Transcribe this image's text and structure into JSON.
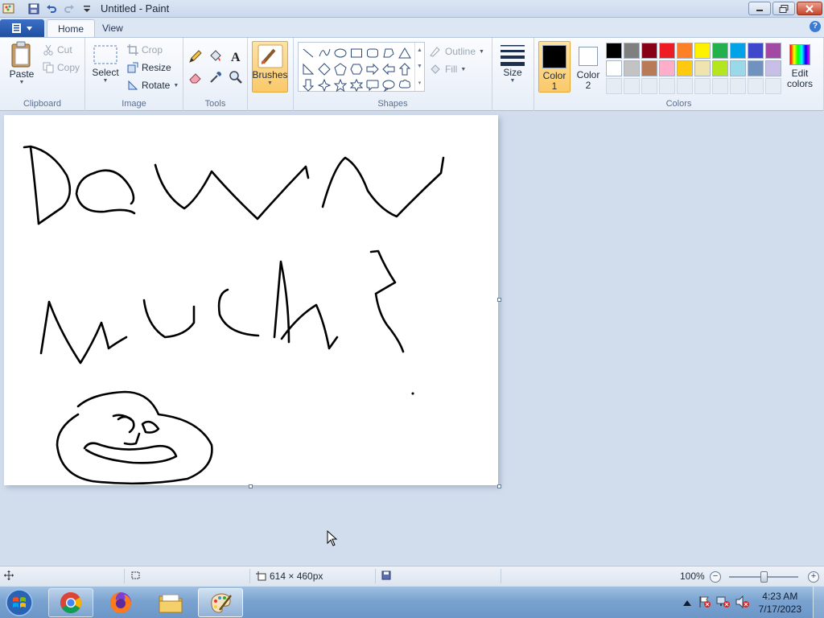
{
  "window": {
    "title": "Untitled - Paint"
  },
  "tabs": [
    {
      "label": "Home",
      "active": true
    },
    {
      "label": "View",
      "active": false
    }
  ],
  "ribbon": {
    "clipboard": {
      "label": "Clipboard",
      "paste": "Paste",
      "cut": "Cut",
      "copy": "Copy"
    },
    "image": {
      "label": "Image",
      "select": "Select",
      "crop": "Crop",
      "resize": "Resize",
      "rotate": "Rotate"
    },
    "tools": {
      "label": "Tools",
      "icons": [
        "pencil-icon",
        "fill-bucket-icon",
        "text-icon",
        "eraser-icon",
        "color-picker-icon",
        "magnifier-icon"
      ]
    },
    "brushes": {
      "label": "Brushes"
    },
    "shapes": {
      "label": "Shapes",
      "outline": "Outline",
      "fill": "Fill",
      "items": [
        "line",
        "curve",
        "oval",
        "rectangle",
        "rounded-rectangle",
        "polygon",
        "triangle",
        "right-triangle",
        "diamond",
        "pentagon",
        "hexagon",
        "right-arrow",
        "left-arrow",
        "up-arrow",
        "down-arrow",
        "four-point-star",
        "five-point-star",
        "six-point-star",
        "rounded-callout",
        "oval-callout",
        "cloud-callout"
      ]
    },
    "size": {
      "label": "Size"
    },
    "colors": {
      "label": "Colors",
      "color1": {
        "line1": "Color",
        "line2": "1",
        "value": "#000000"
      },
      "color2": {
        "line1": "Color",
        "line2": "2",
        "value": "#ffffff"
      },
      "edit": {
        "line1": "Edit",
        "line2": "colors"
      },
      "palette_row1": [
        "#000000",
        "#7f7f7f",
        "#880015",
        "#ed1c24",
        "#ff7f27",
        "#fff200",
        "#22b14c",
        "#00a2e8",
        "#3f48cc",
        "#a349a4"
      ],
      "palette_row2": [
        "#ffffff",
        "#c3c3c3",
        "#b97a57",
        "#ffaec9",
        "#ffc90e",
        "#efe4b0",
        "#b5e61d",
        "#99d9ea",
        "#7092be",
        "#c8bfe7"
      ],
      "palette_row3_empty": 10
    }
  },
  "canvas": {
    "drawing": "handwritten strokes reading 'Down much?' above a doodled face"
  },
  "status": {
    "dimensions": "614 × 460px",
    "zoom": "100%"
  },
  "taskbar": {
    "apps": [
      "chrome-icon",
      "firefox-icon",
      "file-explorer-icon",
      "paint-icon"
    ],
    "time": "4:23 AM",
    "date": "7/17/2023"
  }
}
